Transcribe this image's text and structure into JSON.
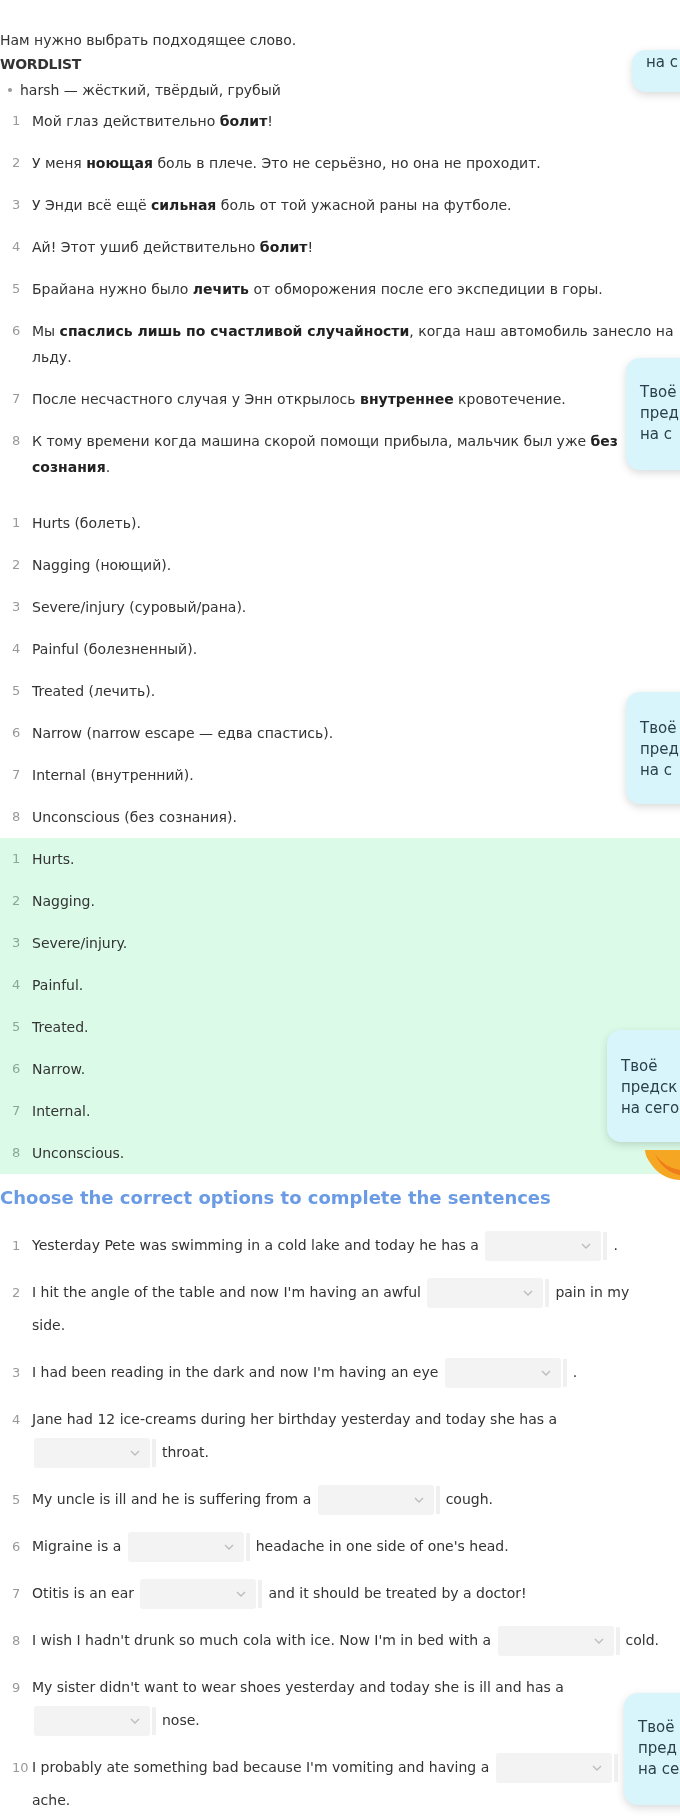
{
  "intro": "Нам нужно выбрать подходящее слово.",
  "wordlist": {
    "title": "WORDLIST",
    "items": [
      "harsh — жёсткий, твёрдый, грубый"
    ]
  },
  "translation": [
    {
      "number": "1",
      "text": "Мой глаз действительно **болит**!"
    },
    {
      "number": "2",
      "text": "У меня **ноющая** боль в плече. Это не серьёзно, но она не проходит."
    },
    {
      "number": "3",
      "text": "У Энди всё ещё **сильная** боль от той ужасной раны на футболе."
    },
    {
      "number": "4",
      "text": "Ай! Этот ушиб действительно **болит**!"
    },
    {
      "number": "5",
      "text": "Брайана нужно было **лечить** от обморожения после его экспедиции в горы."
    },
    {
      "number": "6",
      "text": "Мы **спаслись лишь по счастливой случайности**, когда наш автомобиль занесло на льду."
    },
    {
      "number": "7",
      "text": "После несчастного случая у Энн открылось **внутреннее** кровотечение."
    },
    {
      "number": "8",
      "text": "К тому времени когда машина скорой помощи прибыла, мальчик был уже **без сознания**."
    }
  ],
  "explanation": [
    {
      "number": "1",
      "text": "Hurts (болеть)."
    },
    {
      "number": "2",
      "text": "Nagging (ноющий)."
    },
    {
      "number": "3",
      "text": "Severe/injury (суровый/рана)."
    },
    {
      "number": "4",
      "text": "Painful (болезненный)."
    },
    {
      "number": "5",
      "text": "Treated (лечить)."
    },
    {
      "number": "6",
      "text": "Narrow (narrow escape — едва спастись)."
    },
    {
      "number": "7",
      "text": "Internal (внутренний)."
    },
    {
      "number": "8",
      "text": "Unconscious (без сознания)."
    }
  ],
  "answers": [
    {
      "number": "1",
      "text": "Hurts."
    },
    {
      "number": "2",
      "text": "Nagging."
    },
    {
      "number": "3",
      "text": "Severe/injury."
    },
    {
      "number": "4",
      "text": "Painful."
    },
    {
      "number": "5",
      "text": "Treated."
    },
    {
      "number": "6",
      "text": "Narrow."
    },
    {
      "number": "7",
      "text": "Internal."
    },
    {
      "number": "8",
      "text": "Unconscious."
    }
  ],
  "exercise": {
    "title": "Choose the correct options to complete the sentences",
    "items": [
      {
        "number": "1",
        "before": "Yesterday Pete was swimming in a cold lake and today he has a",
        "after": "."
      },
      {
        "number": "2",
        "before": "I hit the angle of the table and now I'm having an awful",
        "after": [
          "pain in my",
          "side."
        ]
      },
      {
        "number": "3",
        "before": "I had been reading in the dark and now I'm having an eye",
        "after": "."
      },
      {
        "number": "4",
        "before": "Jane had 12 ice-creams during her birthday yesterday and today she has a",
        "after": "throat."
      },
      {
        "number": "5",
        "before": "My uncle is ill and he is suffering from a",
        "after": "cough."
      },
      {
        "number": "6",
        "before": "Migraine is a",
        "after": "headache in one side of one's head."
      },
      {
        "number": "7",
        "before": "Otitis is an ear",
        "after": "and it should be treated by a doctor!"
      },
      {
        "number": "8",
        "before": "I wish I hadn't drunk so much cola with ice. Now I'm in bed with a",
        "after": "cold."
      },
      {
        "number": "9",
        "before": "My sister didn't want to wear shoes yesterday and today she is ill and has a",
        "after": "nose."
      },
      {
        "number": "10",
        "before": "I probably ate something bad because I'm vomiting and having a",
        "after": "ache.",
        "after_on_next_line": true
      }
    ]
  },
  "popups": [
    {
      "lines": [
        "на с"
      ]
    },
    {
      "lines": [
        "Твоё",
        "пред",
        "на с"
      ]
    },
    {
      "lines": [
        "Твоё",
        "пред",
        "на с"
      ]
    },
    {
      "lines": [
        "Твоё",
        "предск",
        "на сего"
      ]
    },
    {
      "lines": [
        "Твоё",
        "пред",
        "на се"
      ]
    }
  ]
}
